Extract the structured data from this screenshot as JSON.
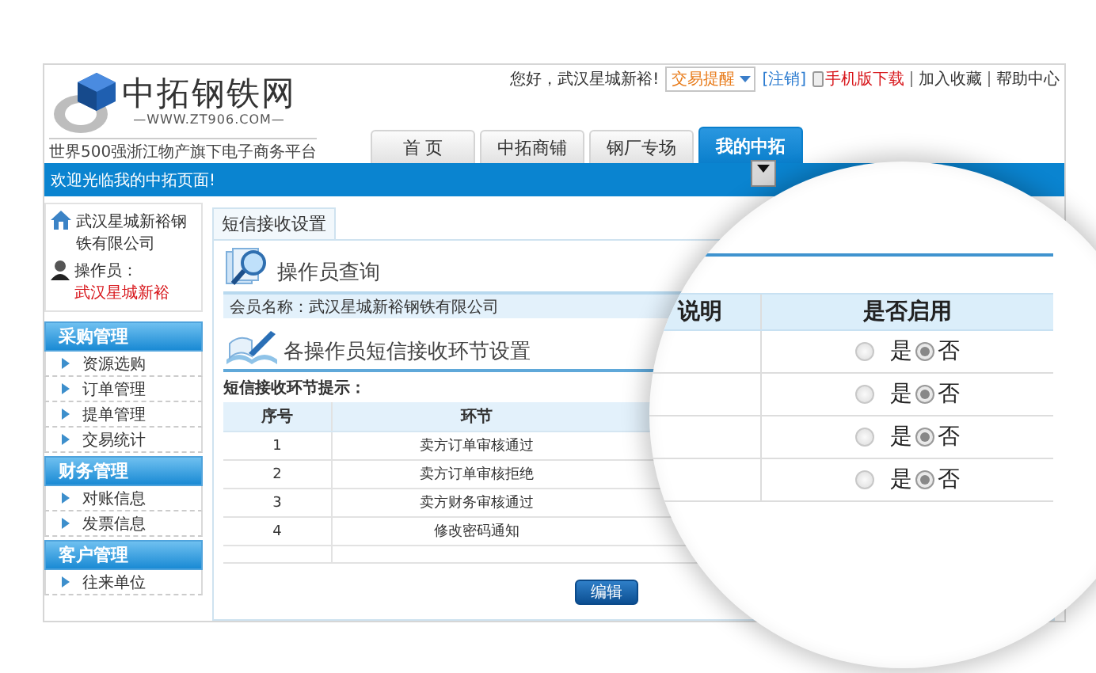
{
  "logo": {
    "name": "中拓钢铁网",
    "url": "—WWW.ZT906.COM—"
  },
  "tagline": "世界500强浙江物产旗下电子商务平台",
  "top_links": {
    "greeting": "您好，武汉星城新裕!",
    "alert_select": "交易提醒",
    "logout": "[注销]",
    "mobile": "手机版下载",
    "favorite": "加入收藏",
    "help": "帮助中心"
  },
  "nav_tabs": [
    {
      "label": "首 页",
      "selected": false
    },
    {
      "label": "中拓商铺",
      "selected": false
    },
    {
      "label": "钢厂专场",
      "selected": false
    },
    {
      "label": "我的中拓",
      "selected": true
    }
  ],
  "welcome": "欢迎光临我的中拓页面!",
  "sidebar": {
    "company": "武汉星城新裕钢铁有限公司",
    "operator_label": "操作员：",
    "operator": "武汉星城新裕",
    "groups": [
      {
        "title": "采购管理",
        "items": [
          "资源选购",
          "订单管理",
          "提单管理",
          "交易统计"
        ]
      },
      {
        "title": "财务管理",
        "items": [
          "对账信息",
          "发票信息"
        ]
      },
      {
        "title": "客户管理",
        "items": [
          "往来单位"
        ]
      }
    ]
  },
  "content": {
    "tabs": [
      "短信接收设置"
    ],
    "query_title": "操作员查询",
    "member": "会员名称：武汉星城新裕钢铁有限公司",
    "settings_title": "各操作员短信接收环节设置",
    "hint": "短信接收环节提示：",
    "table": {
      "columns": [
        "序号",
        "环节"
      ],
      "rows": [
        [
          "1",
          "卖方订单审核通过"
        ],
        [
          "2",
          "卖方订单审核拒绝"
        ],
        [
          "3",
          "卖方财务审核通过"
        ],
        [
          "4",
          "修改密码通知"
        ]
      ]
    },
    "edit_button": "编辑"
  },
  "magnifier": {
    "columns": [
      "说明",
      "是否启用"
    ],
    "rows": [
      {
        "yes": "是",
        "no": "否",
        "enabled": false
      },
      {
        "yes": "是",
        "no": "否",
        "enabled": false
      },
      {
        "yes": "是",
        "no": "否",
        "enabled": false
      },
      {
        "yes": "是",
        "no": "否",
        "enabled": false
      }
    ]
  }
}
